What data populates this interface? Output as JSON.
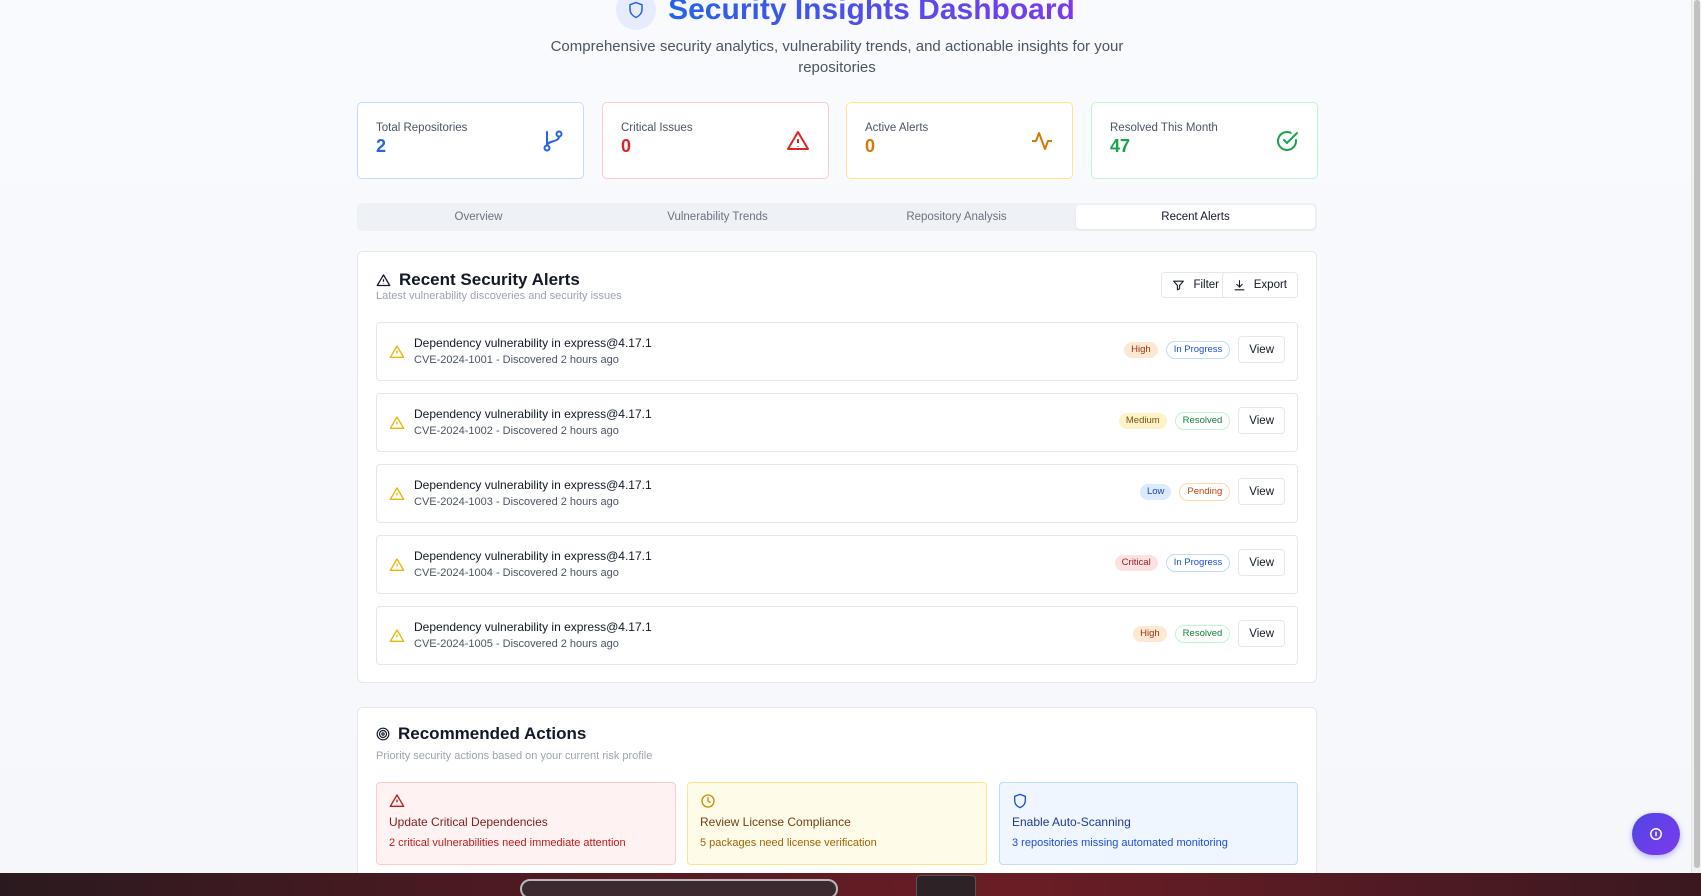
{
  "header": {
    "title": "Security Insights Dashboard",
    "subtitle": "Comprehensive security analytics, vulnerability trends, and actionable insights for your repositories"
  },
  "stats": [
    {
      "label": "Total Repositories",
      "value": "2",
      "icon": "git-branch-icon",
      "color": "#2563eb"
    },
    {
      "label": "Critical Issues",
      "value": "0",
      "icon": "alert-triangle-icon",
      "color": "#dc2626"
    },
    {
      "label": "Active Alerts",
      "value": "0",
      "icon": "activity-icon",
      "color": "#d97706"
    },
    {
      "label": "Resolved This Month",
      "value": "47",
      "icon": "check-circle-icon",
      "color": "#16a34a"
    }
  ],
  "tabs": [
    {
      "label": "Overview",
      "active": false
    },
    {
      "label": "Vulnerability Trends",
      "active": false
    },
    {
      "label": "Repository Analysis",
      "active": false
    },
    {
      "label": "Recent Alerts",
      "active": true
    }
  ],
  "alerts_panel": {
    "title": "Recent Security Alerts",
    "subtitle": "Latest vulnerability discoveries and security issues",
    "filter_label": "Filter",
    "export_label": "Export",
    "view_label": "View",
    "items": [
      {
        "title": "Dependency vulnerability in express@4.17.1",
        "meta": "CVE-2024-1001 - Discovered 2 hours ago",
        "severity": "High",
        "status": "In Progress"
      },
      {
        "title": "Dependency vulnerability in express@4.17.1",
        "meta": "CVE-2024-1002 - Discovered 2 hours ago",
        "severity": "Medium",
        "status": "Resolved"
      },
      {
        "title": "Dependency vulnerability in express@4.17.1",
        "meta": "CVE-2024-1003 - Discovered 2 hours ago",
        "severity": "Low",
        "status": "Pending"
      },
      {
        "title": "Dependency vulnerability in express@4.17.1",
        "meta": "CVE-2024-1004 - Discovered 2 hours ago",
        "severity": "Critical",
        "status": "In Progress"
      },
      {
        "title": "Dependency vulnerability in express@4.17.1",
        "meta": "CVE-2024-1005 - Discovered 2 hours ago",
        "severity": "High",
        "status": "Resolved"
      }
    ]
  },
  "actions_panel": {
    "title": "Recommended Actions",
    "subtitle": "Priority security actions based on your current risk profile",
    "items": [
      {
        "title": "Update Critical Dependencies",
        "desc": "2 critical vulnerabilities need immediate attention",
        "icon": "alert-triangle-icon",
        "color": "#b91c1c"
      },
      {
        "title": "Review License Compliance",
        "desc": "5 packages need license verification",
        "icon": "clock-icon",
        "color": "#a16207"
      },
      {
        "title": "Enable Auto-Scanning",
        "desc": "3 repositories missing automated monitoring",
        "icon": "shield-icon",
        "color": "#1d4ed8"
      }
    ]
  },
  "fab": {
    "icon": "info-icon"
  }
}
